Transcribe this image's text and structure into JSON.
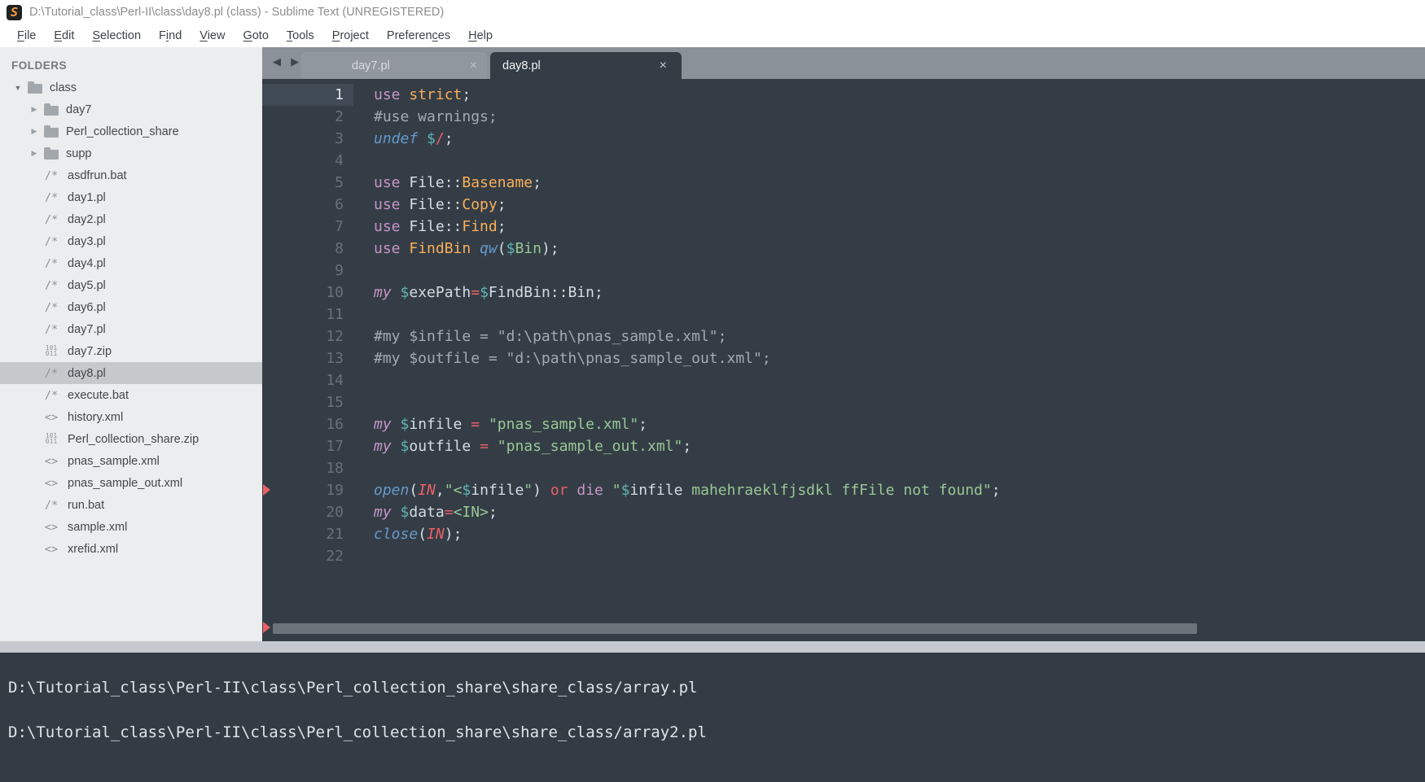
{
  "titlebar": {
    "title": "D:\\Tutorial_class\\Perl-II\\class\\day8.pl (class) - Sublime Text (UNREGISTERED)",
    "logo_glyph": "S"
  },
  "menubar": {
    "items": [
      {
        "label": "File",
        "accel": 0
      },
      {
        "label": "Edit",
        "accel": 0
      },
      {
        "label": "Selection",
        "accel": 0
      },
      {
        "label": "Find",
        "accel": 1
      },
      {
        "label": "View",
        "accel": 0
      },
      {
        "label": "Goto",
        "accel": 0
      },
      {
        "label": "Tools",
        "accel": 0
      },
      {
        "label": "Project",
        "accel": 0
      },
      {
        "label": "Preferences",
        "accel": 8
      },
      {
        "label": "Help",
        "accel": 0
      }
    ]
  },
  "sidebar": {
    "header": "FOLDERS",
    "items": [
      {
        "label": "class",
        "type": "folder",
        "depth": 0,
        "expanded": true
      },
      {
        "label": "day7",
        "type": "folder",
        "depth": 1,
        "expanded": false
      },
      {
        "label": "Perl_collection_share",
        "type": "folder",
        "depth": 1,
        "expanded": false
      },
      {
        "label": "supp",
        "type": "folder",
        "depth": 1,
        "expanded": false
      },
      {
        "label": "asdfrun.bat",
        "type": "perl",
        "depth": 1
      },
      {
        "label": "day1.pl",
        "type": "perl",
        "depth": 1
      },
      {
        "label": "day2.pl",
        "type": "perl",
        "depth": 1
      },
      {
        "label": "day3.pl",
        "type": "perl",
        "depth": 1
      },
      {
        "label": "day4.pl",
        "type": "perl",
        "depth": 1
      },
      {
        "label": "day5.pl",
        "type": "perl",
        "depth": 1
      },
      {
        "label": "day6.pl",
        "type": "perl",
        "depth": 1
      },
      {
        "label": "day7.pl",
        "type": "perl",
        "depth": 1
      },
      {
        "label": "day7.zip",
        "type": "zip",
        "depth": 1
      },
      {
        "label": "day8.pl",
        "type": "perl",
        "depth": 1,
        "selected": true
      },
      {
        "label": "execute.bat",
        "type": "perl",
        "depth": 1
      },
      {
        "label": "history.xml",
        "type": "xml",
        "depth": 1
      },
      {
        "label": "Perl_collection_share.zip",
        "type": "zip",
        "depth": 1
      },
      {
        "label": "pnas_sample.xml",
        "type": "xml",
        "depth": 1
      },
      {
        "label": "pnas_sample_out.xml",
        "type": "xml",
        "depth": 1
      },
      {
        "label": "run.bat",
        "type": "perl",
        "depth": 1
      },
      {
        "label": "sample.xml",
        "type": "xml",
        "depth": 1
      },
      {
        "label": "xrefid.xml",
        "type": "xml",
        "depth": 1
      }
    ]
  },
  "tabs": {
    "nav_arrows": "◀ ▶",
    "close_glyph": "×",
    "items": [
      {
        "label": "day7.pl",
        "active": false
      },
      {
        "label": "day8.pl",
        "active": true
      }
    ]
  },
  "editor": {
    "marked_lines": [
      19
    ],
    "lines": [
      {
        "current": true,
        "tokens": [
          [
            "kw",
            "use"
          ],
          [
            "txt",
            " "
          ],
          [
            "type",
            "strict"
          ],
          [
            "txt",
            ";"
          ]
        ]
      },
      {
        "tokens": [
          [
            "com",
            "#use warnings;"
          ]
        ]
      },
      {
        "tokens": [
          [
            "fn",
            "undef"
          ],
          [
            "txt",
            " "
          ],
          [
            "sig",
            "$"
          ],
          [
            "op",
            "/"
          ],
          [
            "txt",
            ";"
          ]
        ]
      },
      {
        "tokens": []
      },
      {
        "tokens": [
          [
            "kw",
            "use"
          ],
          [
            "txt",
            " File::"
          ],
          [
            "type",
            "Basename"
          ],
          [
            "txt",
            ";"
          ]
        ]
      },
      {
        "tokens": [
          [
            "kw",
            "use"
          ],
          [
            "txt",
            " File::"
          ],
          [
            "type",
            "Copy"
          ],
          [
            "txt",
            ";"
          ]
        ]
      },
      {
        "tokens": [
          [
            "kw",
            "use"
          ],
          [
            "txt",
            " File::"
          ],
          [
            "type",
            "Find"
          ],
          [
            "txt",
            ";"
          ]
        ]
      },
      {
        "tokens": [
          [
            "kw",
            "use"
          ],
          [
            "txt",
            " "
          ],
          [
            "type",
            "FindBin"
          ],
          [
            "txt",
            " "
          ],
          [
            "fn",
            "qw"
          ],
          [
            "txt",
            "("
          ],
          [
            "sig",
            "$"
          ],
          [
            "str",
            "Bin"
          ],
          [
            "txt",
            ");"
          ]
        ]
      },
      {
        "tokens": []
      },
      {
        "tokens": [
          [
            "kwi",
            "my"
          ],
          [
            "txt",
            " "
          ],
          [
            "sig",
            "$"
          ],
          [
            "txt",
            "exePath"
          ],
          [
            "op",
            "="
          ],
          [
            "sig",
            "$"
          ],
          [
            "txt",
            "FindBin::Bin"
          ],
          [
            "txt",
            ";"
          ]
        ]
      },
      {
        "tokens": []
      },
      {
        "tokens": [
          [
            "com",
            "#my $infile = \"d:\\path\\pnas_sample.xml\";"
          ]
        ]
      },
      {
        "tokens": [
          [
            "com",
            "#my $outfile = \"d:\\path\\pnas_sample_out.xml\";"
          ]
        ]
      },
      {
        "tokens": []
      },
      {
        "tokens": []
      },
      {
        "tokens": [
          [
            "kwi",
            "my"
          ],
          [
            "txt",
            " "
          ],
          [
            "sig",
            "$"
          ],
          [
            "txt",
            "infile"
          ],
          [
            "txt",
            " "
          ],
          [
            "op",
            "="
          ],
          [
            "txt",
            " "
          ],
          [
            "str",
            "\"pnas_sample.xml\""
          ],
          [
            "txt",
            ";"
          ]
        ]
      },
      {
        "tokens": [
          [
            "kwi",
            "my"
          ],
          [
            "txt",
            " "
          ],
          [
            "sig",
            "$"
          ],
          [
            "txt",
            "outfile"
          ],
          [
            "txt",
            " "
          ],
          [
            "op",
            "="
          ],
          [
            "txt",
            " "
          ],
          [
            "str",
            "\"pnas_sample_out.xml\""
          ],
          [
            "txt",
            ";"
          ]
        ]
      },
      {
        "tokens": []
      },
      {
        "tokens": [
          [
            "fn",
            "open"
          ],
          [
            "txt",
            "("
          ],
          [
            "opi",
            "IN"
          ],
          [
            "txt",
            ","
          ],
          [
            "str",
            "\"<"
          ],
          [
            "sig",
            "$"
          ],
          [
            "txt",
            "infile"
          ],
          [
            "str",
            "\""
          ],
          [
            "txt",
            ") "
          ],
          [
            "op",
            "or"
          ],
          [
            "txt",
            " "
          ],
          [
            "kw",
            "die"
          ],
          [
            "txt",
            " "
          ],
          [
            "str",
            "\""
          ],
          [
            "sig",
            "$"
          ],
          [
            "txt",
            "infile"
          ],
          [
            "str",
            " mahehraeklfjsdkl ffFile not found\""
          ],
          [
            "txt",
            ";"
          ]
        ]
      },
      {
        "tokens": [
          [
            "kwi",
            "my"
          ],
          [
            "txt",
            " "
          ],
          [
            "sig",
            "$"
          ],
          [
            "txt",
            "data"
          ],
          [
            "op",
            "="
          ],
          [
            "str",
            "<IN>"
          ],
          [
            "txt",
            ";"
          ]
        ]
      },
      {
        "tokens": [
          [
            "fn",
            "close"
          ],
          [
            "txt",
            "("
          ],
          [
            "opi",
            "IN"
          ],
          [
            "txt",
            ")"
          ],
          [
            "txt",
            ";"
          ]
        ]
      },
      {
        "tokens": []
      }
    ]
  },
  "console": {
    "lines": [
      "D:\\Tutorial_class\\Perl-II\\class\\Perl_collection_share\\share_class/array.pl",
      "D:\\Tutorial_class\\Perl-II\\class\\Perl_collection_share\\share_class/array2.pl"
    ]
  },
  "colors": {
    "editor_bg": "#343d46",
    "sidebar_bg": "#ebedee",
    "sidebar_selected": "#c6c9cc",
    "tabbar_bg": "#8a9199",
    "keyword": "#c695c6",
    "function": "#6699cc",
    "module": "#f9ae58",
    "string": "#99c794",
    "sigil": "#5fb4b4",
    "operator": "#ec5f66",
    "comment": "#a2a9b2",
    "code_text": "#d5dbe2",
    "logo_orange": "#ff9a3c"
  }
}
